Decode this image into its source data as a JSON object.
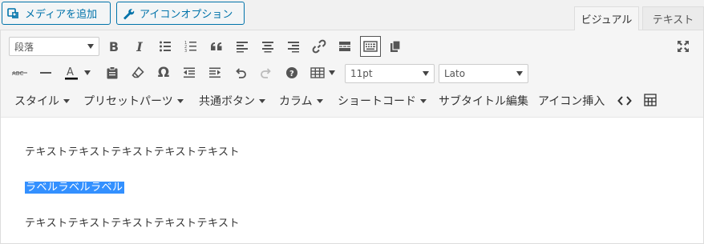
{
  "top_buttons": {
    "add_media": "メディアを追加",
    "icon_options": "アイコンオプション"
  },
  "tabs": {
    "visual": "ビジュアル",
    "text": "テキスト",
    "active": "visual"
  },
  "toolbar": {
    "format_select": "段落",
    "font_size": "11pt",
    "font_family": "Lato",
    "row1_icons": [
      "bold-icon",
      "italic-icon",
      "bullet-list-icon",
      "numbered-list-icon",
      "blockquote-icon",
      "align-left-icon",
      "align-center-icon",
      "align-right-icon",
      "link-icon",
      "read-more-icon",
      "toolbar-toggle-icon",
      "copy-icon"
    ],
    "row2_icons": [
      "strikethrough-icon",
      "horizontal-line-icon",
      "text-color-icon",
      "paste-text-icon",
      "clear-formatting-icon",
      "special-character-icon",
      "outdent-icon",
      "indent-icon",
      "undo-icon",
      "redo-icon",
      "help-icon",
      "table-icon"
    ],
    "fullscreen_icon": "fullscreen-icon",
    "colors": {
      "text_color_bar": "#000000"
    }
  },
  "menus": [
    {
      "label": "スタイル",
      "dropdown": true
    },
    {
      "label": "プリセットパーツ",
      "dropdown": true
    },
    {
      "label": "共通ボタン",
      "dropdown": true
    },
    {
      "label": "カラム",
      "dropdown": true
    },
    {
      "label": "ショートコード",
      "dropdown": true
    },
    {
      "label": "サブタイトル編集",
      "dropdown": false
    },
    {
      "label": "アイコン挿入",
      "dropdown": false
    }
  ],
  "menu_icons": [
    "code-icon",
    "table-insert-icon"
  ],
  "content": {
    "paragraphs": [
      "テキストテキストテキストテキストテキスト",
      "ラベルラベルラベル",
      "テキストテキストテキストテキストテキスト"
    ],
    "selected_index": 1,
    "selection_color": "#3390ff"
  }
}
